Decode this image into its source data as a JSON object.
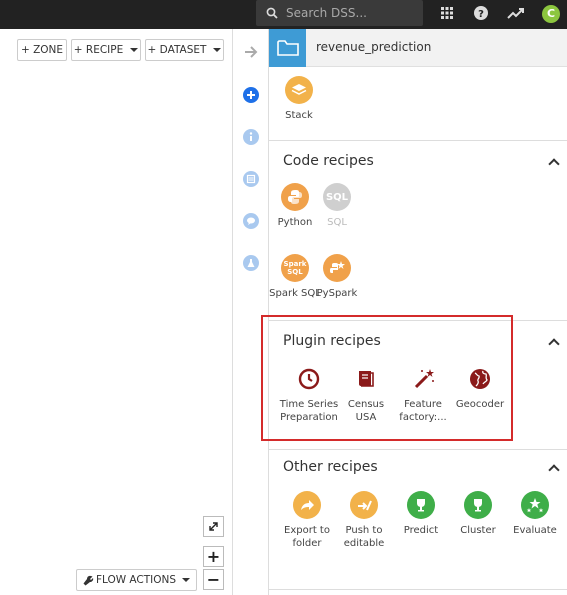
{
  "topbar": {
    "search_placeholder": "Search DSS...",
    "avatar_letter": "C"
  },
  "toolbar": {
    "zone_label": "+ ZONE",
    "recipe_label": "+ RECIPE",
    "dataset_label": "+ DATASET"
  },
  "flow": {
    "flow_actions_label": "FLOW ACTIONS",
    "zoom_in": "+",
    "zoom_out": "−"
  },
  "panel": {
    "title": "revenue_prediction",
    "top_item": "Stack",
    "sections": {
      "code": {
        "title": "Code recipes",
        "items": [
          "Python",
          "SQL",
          "Spark SQL",
          "PySpark"
        ]
      },
      "plugin": {
        "title": "Plugin recipes",
        "items": [
          "Time Series Preparation",
          "Census USA",
          "Feature factory:...",
          "Geocoder"
        ]
      },
      "other": {
        "title": "Other recipes",
        "items": [
          "Export to folder",
          "Push to editable",
          "Predict",
          "Cluster",
          "Evaluate"
        ]
      }
    }
  },
  "colors": {
    "accent_orange": "#f0a14a",
    "accent_green": "#3fae49",
    "highlight_red": "#d42b2b",
    "plugin_icon": "#8b1a1a",
    "folder_blue": "#3e9bd5"
  }
}
